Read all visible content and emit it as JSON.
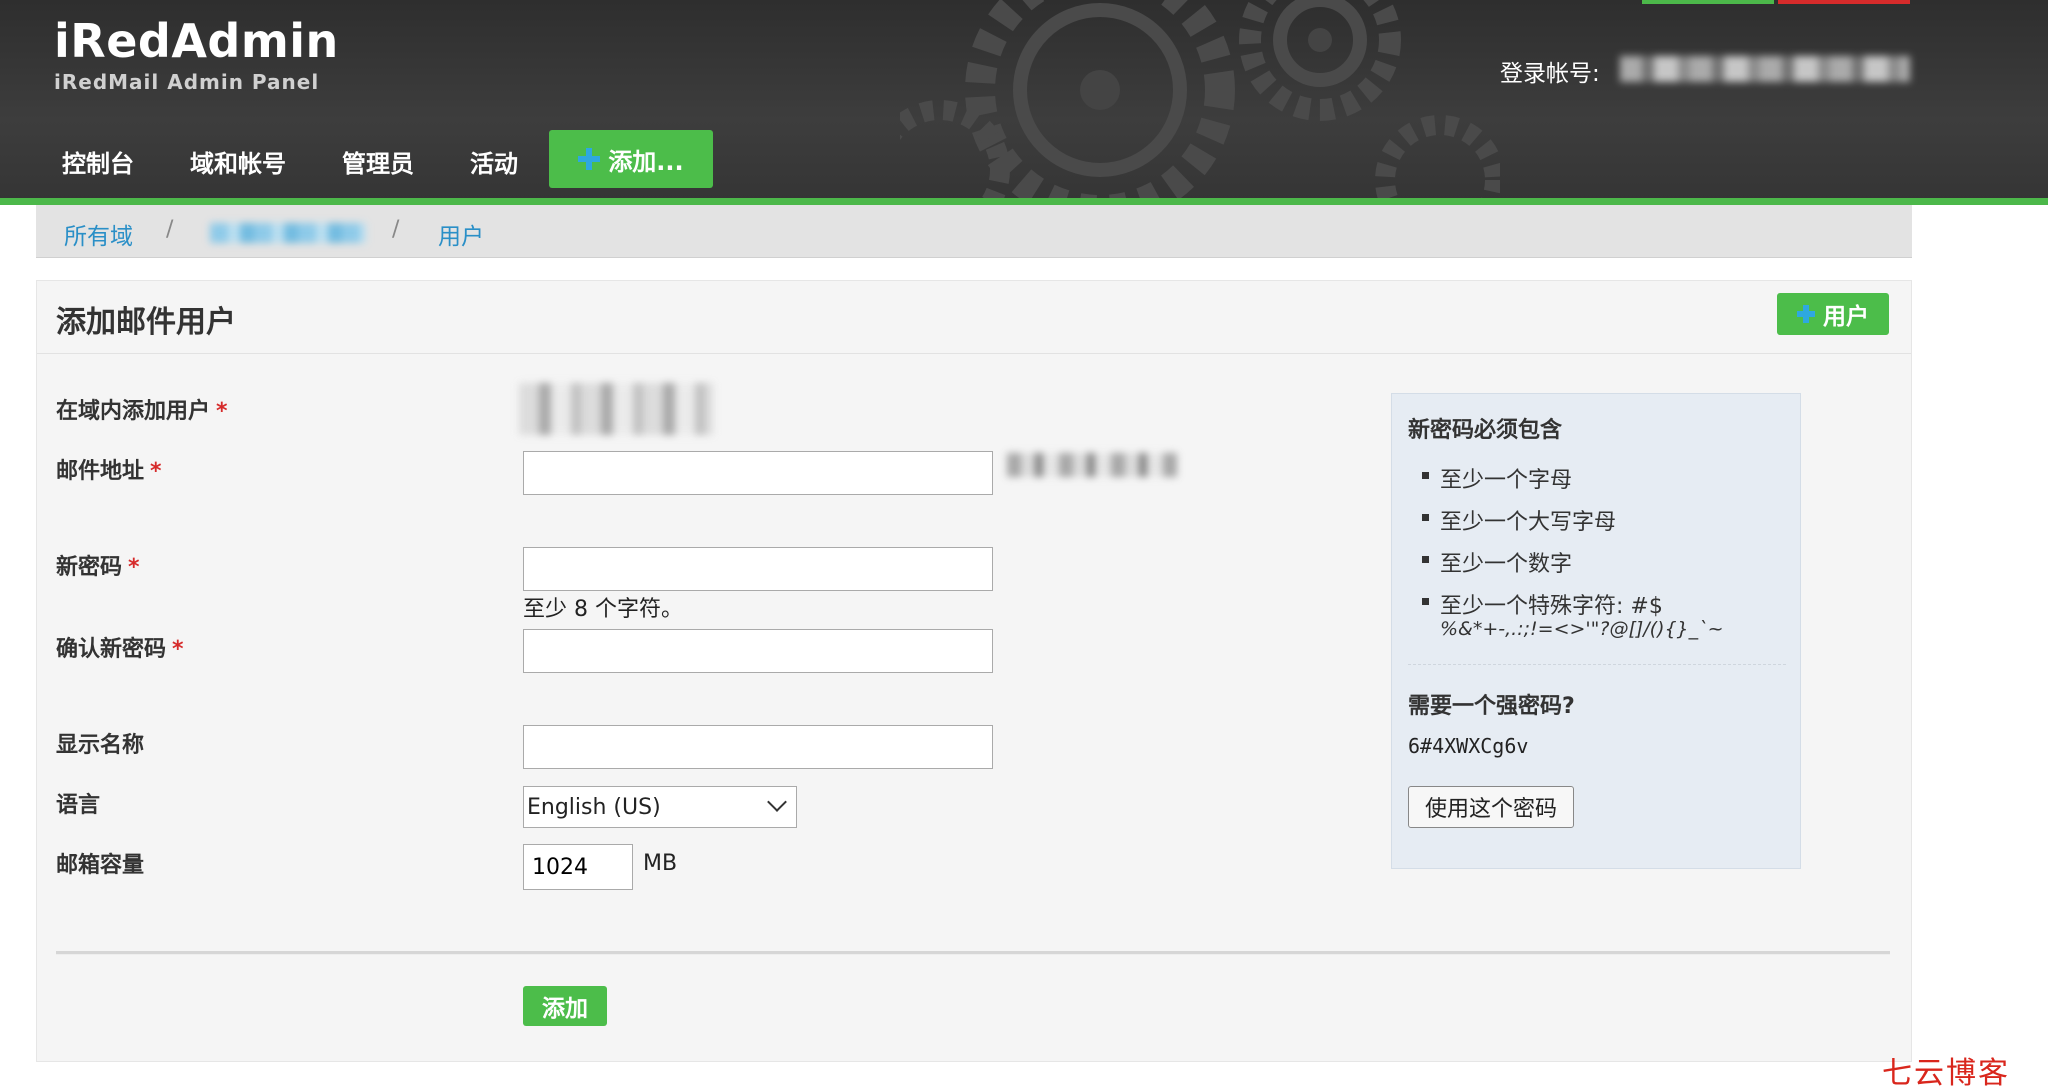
{
  "header": {
    "logo_title": "iRedAdmin",
    "logo_subtitle": "iRedMail Admin Panel",
    "login_label": "登录帐号:",
    "nav": [
      {
        "label": "控制台"
      },
      {
        "label": "域和帐号"
      },
      {
        "label": "管理员"
      },
      {
        "label": "活动"
      }
    ],
    "add_menu_label": "添加..."
  },
  "breadcrumb": {
    "all_domains": "所有域",
    "separator": "/",
    "users": "用户"
  },
  "page": {
    "title": "添加邮件用户",
    "add_user_button": "用户"
  },
  "form": {
    "domain_label": "在域内添加用户",
    "email_label": "邮件地址",
    "password_label": "新密码",
    "password_hint": "至少 8 个字符。",
    "confirm_label": "确认新密码",
    "display_name_label": "显示名称",
    "language_label": "语言",
    "language_value": "English (US)",
    "quota_label": "邮箱容量",
    "quota_value": "1024",
    "quota_unit": "MB",
    "required_mark": "*",
    "submit_label": "添加"
  },
  "password_rules": {
    "title": "新密码必须包含",
    "items": [
      "至少一个字母",
      "至少一个大写字母",
      "至少一个数字",
      "至少一个特殊字符: #$"
    ],
    "special_chars": "%&*+-,.:;!=<>'\"?@[]/(){}_`~",
    "strong_title": "需要一个强密码?",
    "strong_password": "6#4XWXCg6v",
    "use_button": "使用这个密码"
  },
  "watermark": "七云博客",
  "colors": {
    "accent_green": "#4cbd4a",
    "link_blue": "#2a8fc7",
    "required_red": "#d62b2b"
  }
}
